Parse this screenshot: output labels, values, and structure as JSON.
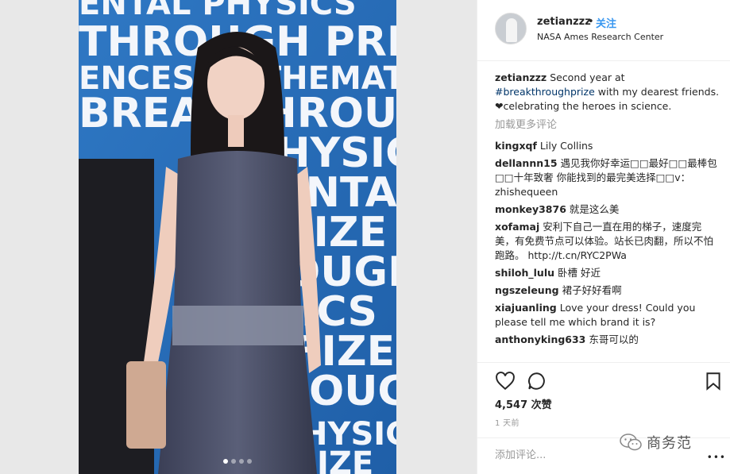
{
  "post": {
    "username": "zetianzzz",
    "separator": "•",
    "follow_label": "关注",
    "location": "NASA Ames Research Center",
    "carousel": {
      "count": 4,
      "active_index": 0
    },
    "photo_backdrop_text": [
      "ENTAL PHYSICS",
      "THROUGH PRIZE",
      "ENCES MATHEMATICS",
      "BREAKTHROUGH",
      "PHYSICS",
      "ENTAL",
      "FIZE",
      "OUGH",
      "ICS",
      "FIZE",
      "OUGH",
      "HYSICS",
      "IZE"
    ]
  },
  "caption": {
    "user": "zetianzzz",
    "text_before": "Second year at",
    "hashtag": "#breakthroughprize",
    "text_after": "with my dearest friends. ❤celebrating the heroes in science."
  },
  "load_more_label": "加载更多评论",
  "comments": [
    {
      "user": "kingxqf",
      "text": "Lily Collins"
    },
    {
      "user": "dellannn15",
      "text": "遇见我你好幸运□□最好□□最棒包□□十年致奢 你能找到的最完美选择□□v：zhishequeen"
    },
    {
      "user": "monkey3876",
      "text": "就是这么美"
    },
    {
      "user": "xofamaj",
      "text": "安利下自己一直在用的梯子，速度完美，有免费节点可以体验。站长已肉翻，所以不怕跑路。 http://t.cn/RYC2PWa"
    },
    {
      "user": "shiloh_lulu",
      "text": "卧槽 好近"
    },
    {
      "user": "ngszeleung",
      "text": "裙子好好看啊"
    },
    {
      "user": "xiajuanling",
      "text": "Love your dress! Could you please tell me which brand it is?"
    },
    {
      "user": "anthonyking633",
      "text": "东哥可以的"
    }
  ],
  "actions": {
    "like_icon": "heart-icon",
    "comment_icon": "speech-bubble-icon",
    "save_icon": "bookmark-icon"
  },
  "likes_label": "4,547 次赞",
  "time_label": "1 天前",
  "add_comment_placeholder": "添加评论...",
  "more_label": "•••",
  "watermark": {
    "text": "商务范",
    "icon": "wechat-logo-icon"
  }
}
